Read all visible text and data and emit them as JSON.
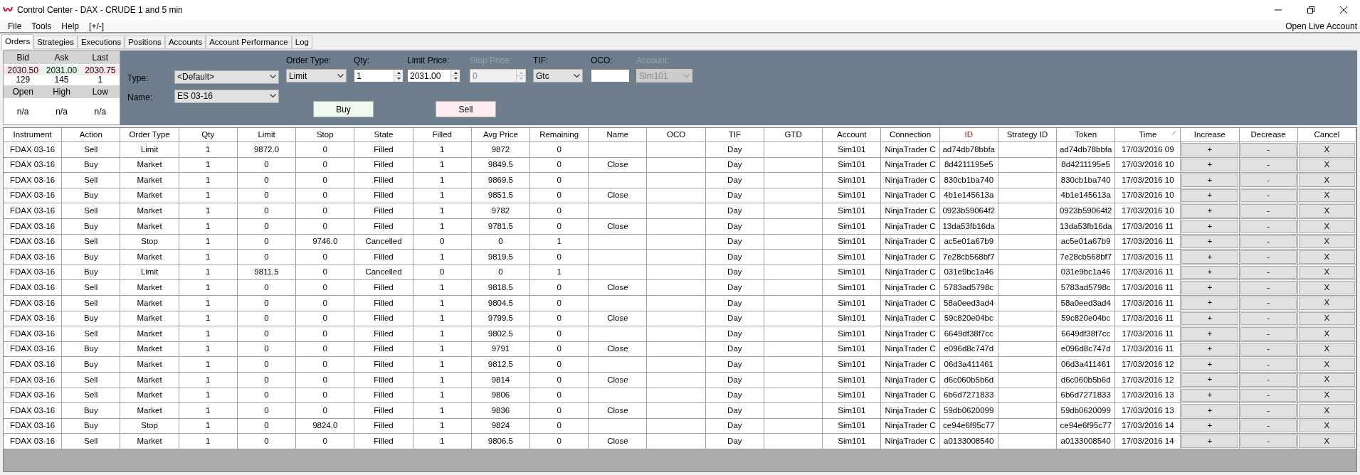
{
  "window": {
    "title": "Control Center - DAX - CRUDE 1 and 5 min"
  },
  "menu": [
    "File",
    "Tools",
    "Help",
    "[+/-]"
  ],
  "menu_right": "Open Live Account",
  "tabs": [
    {
      "label": "Orders",
      "selected": true
    },
    {
      "label": "Strategies",
      "selected": false
    },
    {
      "label": "Executions",
      "selected": false
    },
    {
      "label": "Positions",
      "selected": false
    },
    {
      "label": "Accounts",
      "selected": false
    },
    {
      "label": "Account Performance",
      "selected": false
    },
    {
      "label": "Log",
      "selected": false
    }
  ],
  "quote": {
    "columns": [
      "Bid",
      "Ask",
      "Last"
    ],
    "prices": [
      {
        "value": "2030.50",
        "color": "#fde6ea"
      },
      {
        "value": "2031.00",
        "color": "#e6f7ea"
      },
      {
        "value": "2030.75",
        "color": "#fde6ea"
      }
    ],
    "sizes": [
      "129",
      "145",
      "1"
    ],
    "stats_columns": [
      "Open",
      "High",
      "Low"
    ],
    "stats": [
      "n/a",
      "n/a",
      "n/a"
    ]
  },
  "order_form": {
    "selectors": [
      {
        "label": "Type:",
        "value": "<Default>"
      },
      {
        "label": "Name:",
        "value": "ES 03-16"
      }
    ],
    "fields": [
      {
        "label": "Order Type:",
        "kind": "dropdown",
        "value": "Limit",
        "disabled": false
      },
      {
        "label": "Qty:",
        "kind": "spinner",
        "value": "1",
        "disabled": false
      },
      {
        "label": "Limit Price:",
        "kind": "spinner",
        "value": "2031.00",
        "disabled": false
      },
      {
        "label": "Stop Price:",
        "kind": "spinner",
        "value": "0",
        "disabled": true
      },
      {
        "label": "TIF:",
        "kind": "dropdown",
        "value": "Gtc",
        "disabled": false
      },
      {
        "label": "OCO:",
        "kind": "text",
        "disabled": false
      },
      {
        "label": "Account:",
        "kind": "dropdown",
        "value": "Sim101",
        "disabled": true
      }
    ],
    "buttons": [
      {
        "label": "Buy",
        "kind": "buy"
      },
      {
        "label": "Sell",
        "kind": "sell"
      }
    ]
  },
  "table": {
    "columns": [
      {
        "label": "Instrument",
        "highlighted": false,
        "sorted": false
      },
      {
        "label": "Action",
        "highlighted": false,
        "sorted": false
      },
      {
        "label": "Order Type",
        "highlighted": false,
        "sorted": false
      },
      {
        "label": "Qty",
        "highlighted": false,
        "sorted": false
      },
      {
        "label": "Limit",
        "highlighted": false,
        "sorted": false
      },
      {
        "label": "Stop",
        "highlighted": false,
        "sorted": false
      },
      {
        "label": "State",
        "highlighted": false,
        "sorted": false
      },
      {
        "label": "Filled",
        "highlighted": false,
        "sorted": false
      },
      {
        "label": "Avg Price",
        "highlighted": false,
        "sorted": false
      },
      {
        "label": "Remaining",
        "highlighted": false,
        "sorted": false
      },
      {
        "label": "Name",
        "highlighted": false,
        "sorted": false
      },
      {
        "label": "OCO",
        "highlighted": false,
        "sorted": false
      },
      {
        "label": "TIF",
        "highlighted": false,
        "sorted": false
      },
      {
        "label": "GTD",
        "highlighted": false,
        "sorted": false
      },
      {
        "label": "Account",
        "highlighted": false,
        "sorted": false
      },
      {
        "label": "Connection",
        "highlighted": false,
        "sorted": false
      },
      {
        "label": "ID",
        "highlighted": true,
        "sorted": false
      },
      {
        "label": "Strategy ID",
        "highlighted": false,
        "sorted": false
      },
      {
        "label": "Token",
        "highlighted": false,
        "sorted": false
      },
      {
        "label": "Time",
        "highlighted": false,
        "sorted": true
      },
      {
        "label": "Increase",
        "highlighted": false,
        "sorted": false
      },
      {
        "label": "Decrease",
        "highlighted": false,
        "sorted": false
      },
      {
        "label": "Cancel",
        "highlighted": false,
        "sorted": false
      }
    ],
    "rows": [
      {
        "instrument": "FDAX 03-16",
        "action": "Sell",
        "order_type": "Limit",
        "qty": "1",
        "limit": "9872.0",
        "stop": "0",
        "state": "Filled",
        "filled": "1",
        "avg_price": "9872",
        "remaining": "0",
        "tif": "Day",
        "account": "Sim101",
        "connection": "NinjaTrader C",
        "id": "ad74db78bbfa",
        "token": "ad74db78bbfa",
        "time": "17/03/2016 09",
        "increase": "+",
        "decrease": "-",
        "cancel": "X"
      },
      {
        "instrument": "FDAX 03-16",
        "action": "Buy",
        "order_type": "Market",
        "qty": "1",
        "limit": "0",
        "stop": "0",
        "state": "Filled",
        "filled": "1",
        "avg_price": "9849.5",
        "remaining": "0",
        "name": "Close",
        "tif": "Day",
        "account": "Sim101",
        "connection": "NinjaTrader C",
        "id": "8d4211195e5",
        "token": "8d4211195e5",
        "time": "17/03/2016 10",
        "increase": "+",
        "decrease": "-",
        "cancel": "X"
      },
      {
        "instrument": "FDAX 03-16",
        "action": "Sell",
        "order_type": "Market",
        "qty": "1",
        "limit": "0",
        "stop": "0",
        "state": "Filled",
        "filled": "1",
        "avg_price": "9869.5",
        "remaining": "0",
        "tif": "Day",
        "account": "Sim101",
        "connection": "NinjaTrader C",
        "id": "830cb1ba740",
        "token": "830cb1ba740",
        "time": "17/03/2016 10",
        "increase": "+",
        "decrease": "-",
        "cancel": "X"
      },
      {
        "instrument": "FDAX 03-16",
        "action": "Buy",
        "order_type": "Market",
        "qty": "1",
        "limit": "0",
        "stop": "0",
        "state": "Filled",
        "filled": "1",
        "avg_price": "9851.5",
        "remaining": "0",
        "name": "Close",
        "tif": "Day",
        "account": "Sim101",
        "connection": "NinjaTrader C",
        "id": "4b1e145613a",
        "token": "4b1e145613a",
        "time": "17/03/2016 10",
        "increase": "+",
        "decrease": "-",
        "cancel": "X"
      },
      {
        "instrument": "FDAX 03-16",
        "action": "Sell",
        "order_type": "Market",
        "qty": "1",
        "limit": "0",
        "stop": "0",
        "state": "Filled",
        "filled": "1",
        "avg_price": "9782",
        "remaining": "0",
        "tif": "Day",
        "account": "Sim101",
        "connection": "NinjaTrader C",
        "id": "0923b59064f2",
        "token": "0923b59064f2",
        "time": "17/03/2016 10",
        "increase": "+",
        "decrease": "-",
        "cancel": "X"
      },
      {
        "instrument": "FDAX 03-16",
        "action": "Buy",
        "order_type": "Market",
        "qty": "1",
        "limit": "0",
        "stop": "0",
        "state": "Filled",
        "filled": "1",
        "avg_price": "9781.5",
        "remaining": "0",
        "name": "Close",
        "tif": "Day",
        "account": "Sim101",
        "connection": "NinjaTrader C",
        "id": "13da53fb16da",
        "token": "13da53fb16da",
        "time": "17/03/2016 11",
        "increase": "+",
        "decrease": "-",
        "cancel": "X"
      },
      {
        "instrument": "FDAX 03-16",
        "action": "Sell",
        "order_type": "Stop",
        "qty": "1",
        "limit": "0",
        "stop": "9746.0",
        "state": "Cancelled",
        "filled": "0",
        "avg_price": "0",
        "remaining": "1",
        "tif": "Day",
        "account": "Sim101",
        "connection": "NinjaTrader C",
        "id": "ac5e01a67b9",
        "token": "ac5e01a67b9",
        "time": "17/03/2016 11",
        "increase": "+",
        "decrease": "-",
        "cancel": "X"
      },
      {
        "instrument": "FDAX 03-16",
        "action": "Buy",
        "order_type": "Market",
        "qty": "1",
        "limit": "0",
        "stop": "0",
        "state": "Filled",
        "filled": "1",
        "avg_price": "9819.5",
        "remaining": "0",
        "tif": "Day",
        "account": "Sim101",
        "connection": "NinjaTrader C",
        "id": "7e28cb568bf7",
        "token": "7e28cb568bf7",
        "time": "17/03/2016 11",
        "increase": "+",
        "decrease": "-",
        "cancel": "X"
      },
      {
        "instrument": "FDAX 03-16",
        "action": "Buy",
        "order_type": "Limit",
        "qty": "1",
        "limit": "9811.5",
        "stop": "0",
        "state": "Cancelled",
        "filled": "0",
        "avg_price": "0",
        "remaining": "1",
        "tif": "Day",
        "account": "Sim101",
        "connection": "NinjaTrader C",
        "id": "031e9bc1a46",
        "token": "031e9bc1a46",
        "time": "17/03/2016 11",
        "increase": "+",
        "decrease": "-",
        "cancel": "X"
      },
      {
        "instrument": "FDAX 03-16",
        "action": "Sell",
        "order_type": "Market",
        "qty": "1",
        "limit": "0",
        "stop": "0",
        "state": "Filled",
        "filled": "1",
        "avg_price": "9818.5",
        "remaining": "0",
        "name": "Close",
        "tif": "Day",
        "account": "Sim101",
        "connection": "NinjaTrader C",
        "id": "5783ad5798c",
        "token": "5783ad5798c",
        "time": "17/03/2016 11",
        "increase": "+",
        "decrease": "-",
        "cancel": "X"
      },
      {
        "instrument": "FDAX 03-16",
        "action": "Sell",
        "order_type": "Market",
        "qty": "1",
        "limit": "0",
        "stop": "0",
        "state": "Filled",
        "filled": "1",
        "avg_price": "9804.5",
        "remaining": "0",
        "tif": "Day",
        "account": "Sim101",
        "connection": "NinjaTrader C",
        "id": "58a0eed3ad4",
        "token": "58a0eed3ad4",
        "time": "17/03/2016 11",
        "increase": "+",
        "decrease": "-",
        "cancel": "X"
      },
      {
        "instrument": "FDAX 03-16",
        "action": "Buy",
        "order_type": "Market",
        "qty": "1",
        "limit": "0",
        "stop": "0",
        "state": "Filled",
        "filled": "1",
        "avg_price": "9799.5",
        "remaining": "0",
        "name": "Close",
        "tif": "Day",
        "account": "Sim101",
        "connection": "NinjaTrader C",
        "id": "59c820e04bc",
        "token": "59c820e04bc",
        "time": "17/03/2016 11",
        "increase": "+",
        "decrease": "-",
        "cancel": "X"
      },
      {
        "instrument": "FDAX 03-16",
        "action": "Sell",
        "order_type": "Market",
        "qty": "1",
        "limit": "0",
        "stop": "0",
        "state": "Filled",
        "filled": "1",
        "avg_price": "9802.5",
        "remaining": "0",
        "tif": "Day",
        "account": "Sim101",
        "connection": "NinjaTrader C",
        "id": "6649df38f7cc",
        "token": "6649df38f7cc",
        "time": "17/03/2016 11",
        "increase": "+",
        "decrease": "-",
        "cancel": "X"
      },
      {
        "instrument": "FDAX 03-16",
        "action": "Buy",
        "order_type": "Market",
        "qty": "1",
        "limit": "0",
        "stop": "0",
        "state": "Filled",
        "filled": "1",
        "avg_price": "9791",
        "remaining": "0",
        "name": "Close",
        "tif": "Day",
        "account": "Sim101",
        "connection": "NinjaTrader C",
        "id": "e096d8c747d",
        "token": "e096d8c747d",
        "time": "17/03/2016 11",
        "increase": "+",
        "decrease": "-",
        "cancel": "X"
      },
      {
        "instrument": "FDAX 03-16",
        "action": "Buy",
        "order_type": "Market",
        "qty": "1",
        "limit": "0",
        "stop": "0",
        "state": "Filled",
        "filled": "1",
        "avg_price": "9812.5",
        "remaining": "0",
        "tif": "Day",
        "account": "Sim101",
        "connection": "NinjaTrader C",
        "id": "06d3a411461",
        "token": "06d3a411461",
        "time": "17/03/2016 12",
        "increase": "+",
        "decrease": "-",
        "cancel": "X"
      },
      {
        "instrument": "FDAX 03-16",
        "action": "Sell",
        "order_type": "Market",
        "qty": "1",
        "limit": "0",
        "stop": "0",
        "state": "Filled",
        "filled": "1",
        "avg_price": "9814",
        "remaining": "0",
        "name": "Close",
        "tif": "Day",
        "account": "Sim101",
        "connection": "NinjaTrader C",
        "id": "d6c060b5b6d",
        "token": "d6c060b5b6d",
        "time": "17/03/2016 12",
        "increase": "+",
        "decrease": "-",
        "cancel": "X"
      },
      {
        "instrument": "FDAX 03-16",
        "action": "Sell",
        "order_type": "Market",
        "qty": "1",
        "limit": "0",
        "stop": "0",
        "state": "Filled",
        "filled": "1",
        "avg_price": "9806",
        "remaining": "0",
        "tif": "Day",
        "account": "Sim101",
        "connection": "NinjaTrader C",
        "id": "6b6d7271833",
        "token": "6b6d7271833",
        "time": "17/03/2016 13",
        "increase": "+",
        "decrease": "-",
        "cancel": "X"
      },
      {
        "instrument": "FDAX 03-16",
        "action": "Buy",
        "order_type": "Market",
        "qty": "1",
        "limit": "0",
        "stop": "0",
        "state": "Filled",
        "filled": "1",
        "avg_price": "9836",
        "remaining": "0",
        "name": "Close",
        "tif": "Day",
        "account": "Sim101",
        "connection": "NinjaTrader C",
        "id": "59db0620099",
        "token": "59db0620099",
        "time": "17/03/2016 13",
        "increase": "+",
        "decrease": "-",
        "cancel": "X"
      },
      {
        "instrument": "FDAX 03-16",
        "action": "Buy",
        "order_type": "Stop",
        "qty": "1",
        "limit": "0",
        "stop": "9824.0",
        "state": "Filled",
        "filled": "1",
        "avg_price": "9824",
        "remaining": "0",
        "tif": "Day",
        "account": "Sim101",
        "connection": "NinjaTrader C",
        "id": "ce94e6f95c77",
        "token": "ce94e6f95c77",
        "time": "17/03/2016 14",
        "increase": "+",
        "decrease": "-",
        "cancel": "X"
      },
      {
        "instrument": "FDAX 03-16",
        "action": "Sell",
        "order_type": "Market",
        "qty": "1",
        "limit": "0",
        "stop": "0",
        "state": "Filled",
        "filled": "1",
        "avg_price": "9806.5",
        "remaining": "0",
        "name": "Close",
        "tif": "Day",
        "account": "Sim101",
        "connection": "NinjaTrader C",
        "id": "a0133008540",
        "token": "a0133008540",
        "time": "17/03/2016 14",
        "increase": "+",
        "decrease": "-",
        "cancel": "X"
      }
    ]
  }
}
